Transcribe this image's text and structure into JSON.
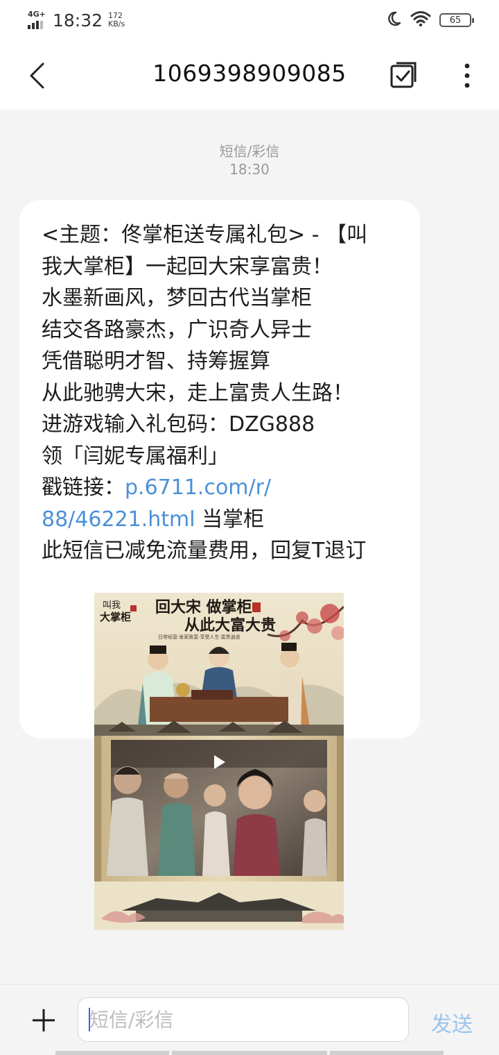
{
  "status_bar": {
    "network": "4G+",
    "time": "18:32",
    "speed_value": "172",
    "speed_unit": "KB/s",
    "battery": "65",
    "icons": [
      "signal-icon",
      "moon-icon",
      "wifi-icon",
      "battery-icon"
    ]
  },
  "header": {
    "title": "1069398909085",
    "icons": [
      "back-arrow-icon",
      "select-checkbox-icon",
      "more-vert-icon"
    ]
  },
  "conversation": {
    "message_type": "短信/彩信",
    "time": "18:30"
  },
  "message": {
    "lines": [
      "<主题：佟掌柜送专属礼包> - 【叫",
      "我大掌柜】一起回大宋享富贵！",
      "水墨新画风，梦回古代当掌柜",
      "结交各路豪杰，广识奇人异士",
      "凭借聪明才智、持筹握算",
      "从此驰骋大宋，走上富贵人生路！",
      "进游戏输入礼包码：DZG888",
      "领「闫妮专属福利」"
    ],
    "link_prefix": "戳链接：",
    "link_part1": "p.6711.com/r/",
    "link_part2": "88/46221.html",
    "link_suffix": " 当掌柜",
    "last_line": "此短信已减免流量费用，回复T退订"
  },
  "poster": {
    "logo_line1": "叫我",
    "logo_line2": "大掌柜",
    "headline1": "回大宋 做掌柜",
    "headline2": "从此大富大贵",
    "tagline": "日常经营·发家致富·享受人生·富贵逍遥",
    "colors": {
      "paper": "#ece2c8",
      "ink": "#1f1a14",
      "seal": "#b8312a",
      "blossom": "#c8484a"
    }
  },
  "composer": {
    "placeholder": "短信/彩信",
    "send_label": "发送"
  }
}
